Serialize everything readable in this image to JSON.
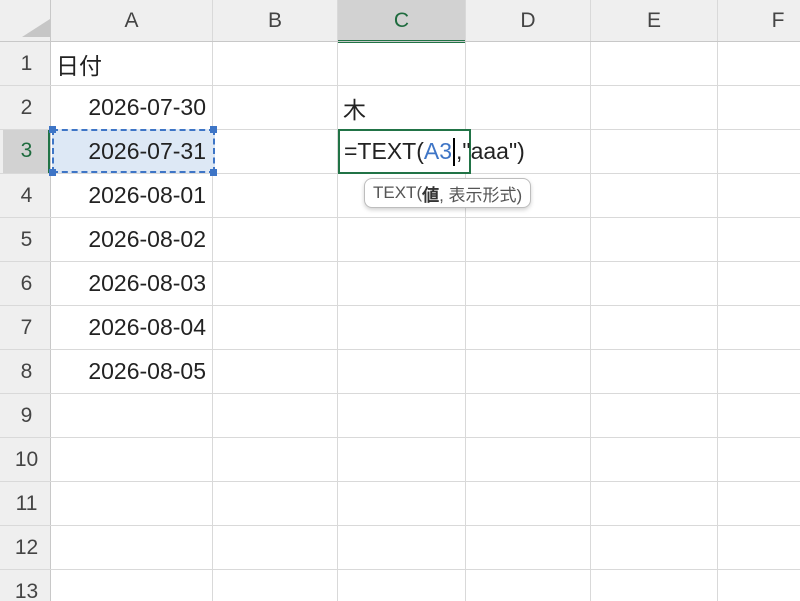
{
  "columns": [
    "A",
    "B",
    "C",
    "D",
    "E",
    "F"
  ],
  "rows": [
    "1",
    "2",
    "3",
    "4",
    "5",
    "6",
    "7",
    "8",
    "9",
    "10",
    "11",
    "12",
    "13"
  ],
  "cells": {
    "A1": "日付",
    "A2": "2026-07-30",
    "A3": "2026-07-31",
    "A4": "2026-08-01",
    "A5": "2026-08-02",
    "A6": "2026-08-03",
    "A7": "2026-08-04",
    "A8": "2026-08-05",
    "C2": "木"
  },
  "editing": {
    "cell": "C3",
    "prefix": "=TEXT(",
    "ref": "A3",
    "suffix": ",\"aaa\")"
  },
  "tooltip": {
    "func": "TEXT(",
    "arg1": "値",
    "rest": ", 表示形式)"
  },
  "active_column": "C",
  "active_row": "3",
  "colors": {
    "accent": "#217346",
    "ref_blue": "#3e75c6",
    "selected_header": "#d2d2d2"
  }
}
